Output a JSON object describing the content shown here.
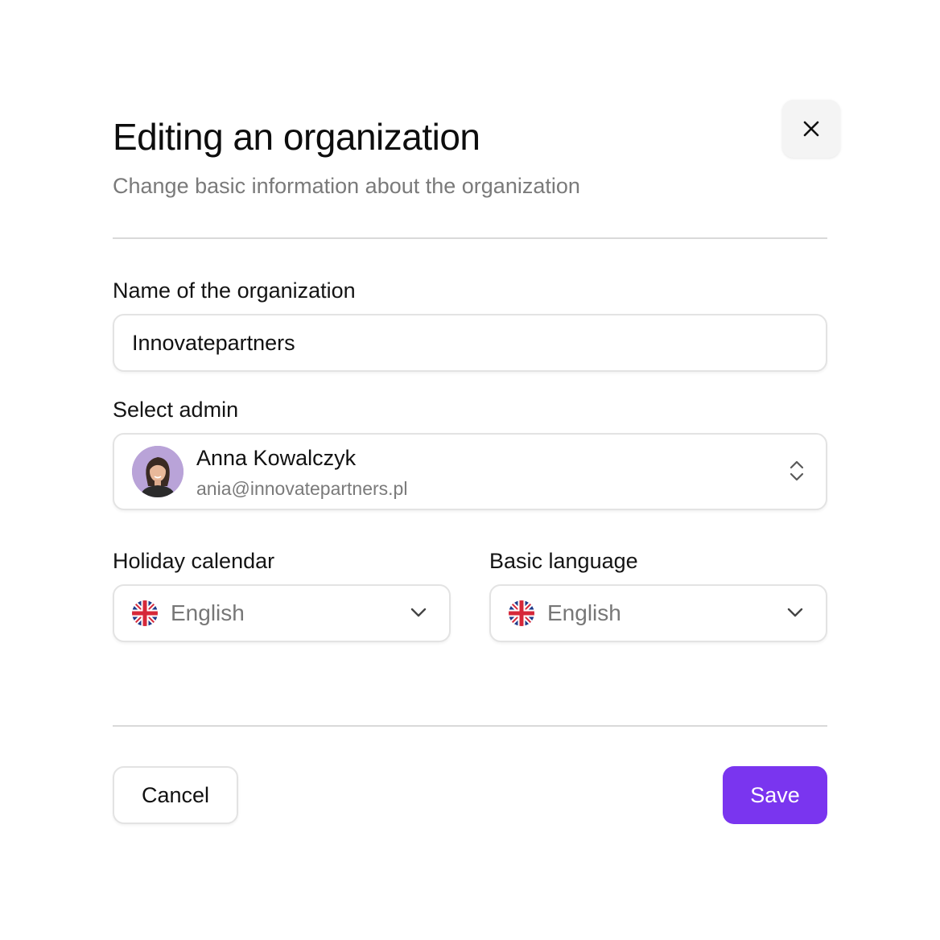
{
  "dialog": {
    "title": "Editing an organization",
    "subtitle": "Change basic information about the organization",
    "close_icon": "close-icon"
  },
  "form": {
    "name_label": "Name of the organization",
    "name_value": "Innovatepartners",
    "admin_label": "Select admin",
    "admin": {
      "name": "Anna Kowalczyk",
      "email": "ania@innovatepartners.pl",
      "avatar_icon": "avatar"
    },
    "holiday_calendar_label": "Holiday calendar",
    "holiday_calendar_value": "English",
    "basic_language_label": "Basic language",
    "basic_language_value": "English",
    "flag_icon": "uk-flag-icon"
  },
  "footer": {
    "cancel_label": "Cancel",
    "save_label": "Save"
  },
  "colors": {
    "accent": "#7a35ef",
    "subtitle_text": "#7a7a7a",
    "border": "#e3e3e3",
    "close_bg": "#f4f4f4"
  }
}
